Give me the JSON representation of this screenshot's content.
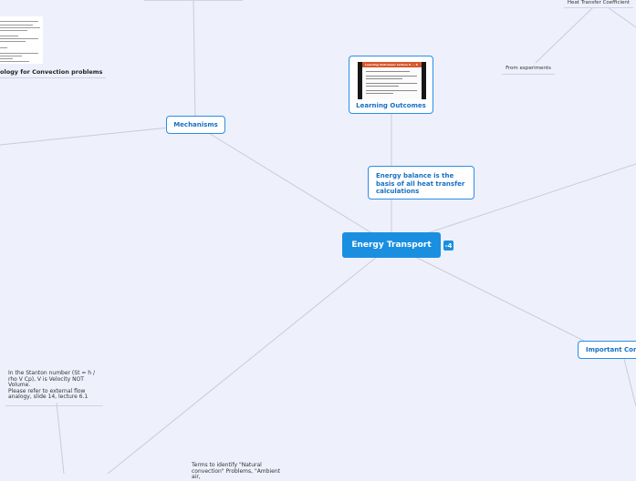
{
  "central": {
    "label": "Energy Transport",
    "collapse_icon": "-4"
  },
  "topics": {
    "mechanisms": "Mechanisms",
    "learning_outcomes": "Learning Outcomes",
    "energy_balance": "Energy balance is the basis of all heat transfer calculations",
    "important": "Important Con"
  },
  "learning_slide_title": "Learning Outcomes: lecture 6 ... 8",
  "notes": {
    "heat_transfer_coefficient": "Heat Transfer Coefficient",
    "from_experiments": "From experiments",
    "terminology": "ology for Convection problems",
    "stanton": "In the Stanton number (St = h / rho V Cp), V is Velocity NOT Volume.\nPlease refer to external flow analogy, slide 14, lecture 6.1",
    "terms": "Terms to identify \"Natural convection\" Problems, \"Ambient air,"
  },
  "colors": {
    "background": "#eef0fc",
    "accent": "#1a8fe0",
    "border": "#2a8ee6",
    "link": "#c9ccd9"
  }
}
